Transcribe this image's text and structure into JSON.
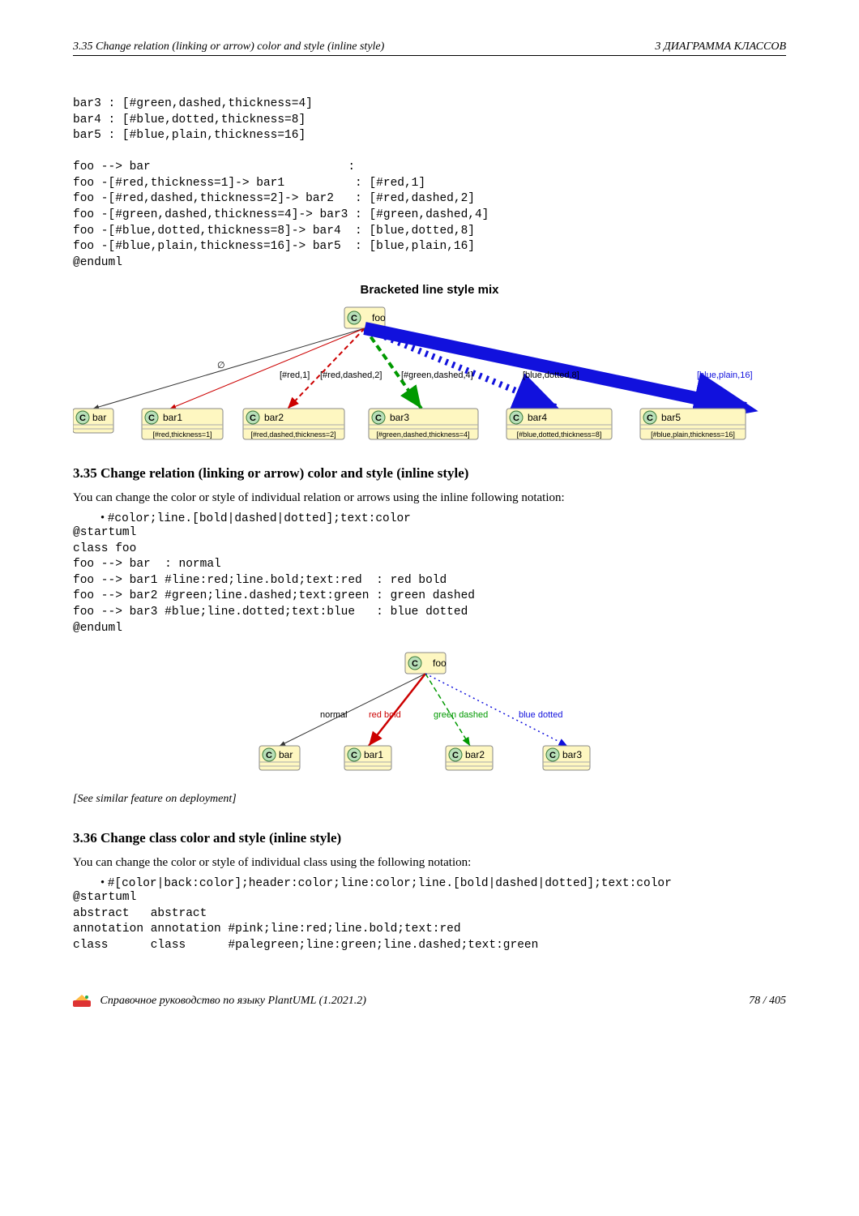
{
  "header": {
    "left": "3.35   Change relation (linking or arrow) color and style (inline style)",
    "right": "3   ДИАГРАММА КЛАССОВ"
  },
  "code_block_1": "bar3 : [#green,dashed,thickness=4]\nbar4 : [#blue,dotted,thickness=8]\nbar5 : [#blue,plain,thickness=16]\n\nfoo --> bar                            :\nfoo -[#red,thickness=1]-> bar1          : [#red,1]\nfoo -[#red,dashed,thickness=2]-> bar2   : [#red,dashed,2]\nfoo -[#green,dashed,thickness=4]-> bar3 : [#green,dashed,4]\nfoo -[#blue,dotted,thickness=8]-> bar4  : [blue,dotted,8]\nfoo -[#blue,plain,thickness=16]-> bar5  : [blue,plain,16]\n@enduml",
  "diagram1": {
    "title": "Bracketed line style mix",
    "foo": "foo",
    "classes": [
      "bar",
      "bar1",
      "bar2",
      "bar3",
      "bar4",
      "bar5"
    ],
    "sublabels": [
      "",
      "[#red,thickness=1]",
      "[#red,dashed,thickness=2]",
      "[#green,dashed,thickness=4]",
      "[#blue,dotted,thickness=8]",
      "[#blue,plain,thickness=16]"
    ],
    "edge_labels": [
      "∅",
      "[#red,1]",
      "[#red,dashed,2]",
      "[#green,dashed,4]",
      "[blue,dotted,8]",
      "[blue,plain,16]"
    ]
  },
  "section_335": {
    "title": "3.35   Change relation (linking or arrow) color and style (inline style)",
    "intro": "You can change the color or style of individual relation or arrows using the inline following notation:",
    "bullet": "#color;line.[bold|dashed|dotted];text:color"
  },
  "code_block_2": "@startuml\nclass foo\nfoo --> bar  : normal\nfoo --> bar1 #line:red;line.bold;text:red  : red bold\nfoo --> bar2 #green;line.dashed;text:green : green dashed\nfoo --> bar3 #blue;line.dotted;text:blue   : blue dotted\n@enduml",
  "diagram2": {
    "foo": "foo",
    "classes": [
      "bar",
      "bar1",
      "bar2",
      "bar3"
    ],
    "edge_labels": [
      "normal",
      "red bold",
      "green dashed",
      "blue dotted"
    ]
  },
  "note": "[See similar feature on deployment]",
  "section_336": {
    "title": "3.36   Change class color and style (inline style)",
    "intro": "You can change the color or style of individual class using the following notation:",
    "bullet": "#[color|back:color];header:color;line:color;line.[bold|dashed|dotted];text:color"
  },
  "code_block_3": "@startuml\nabstract   abstract\nannotation annotation #pink;line:red;line.bold;text:red\nclass      class      #palegreen;line:green;line.dashed;text:green",
  "footer": {
    "left": "Справочное руководство по языку PlantUML (1.2021.2)",
    "right": "78 / 405"
  }
}
